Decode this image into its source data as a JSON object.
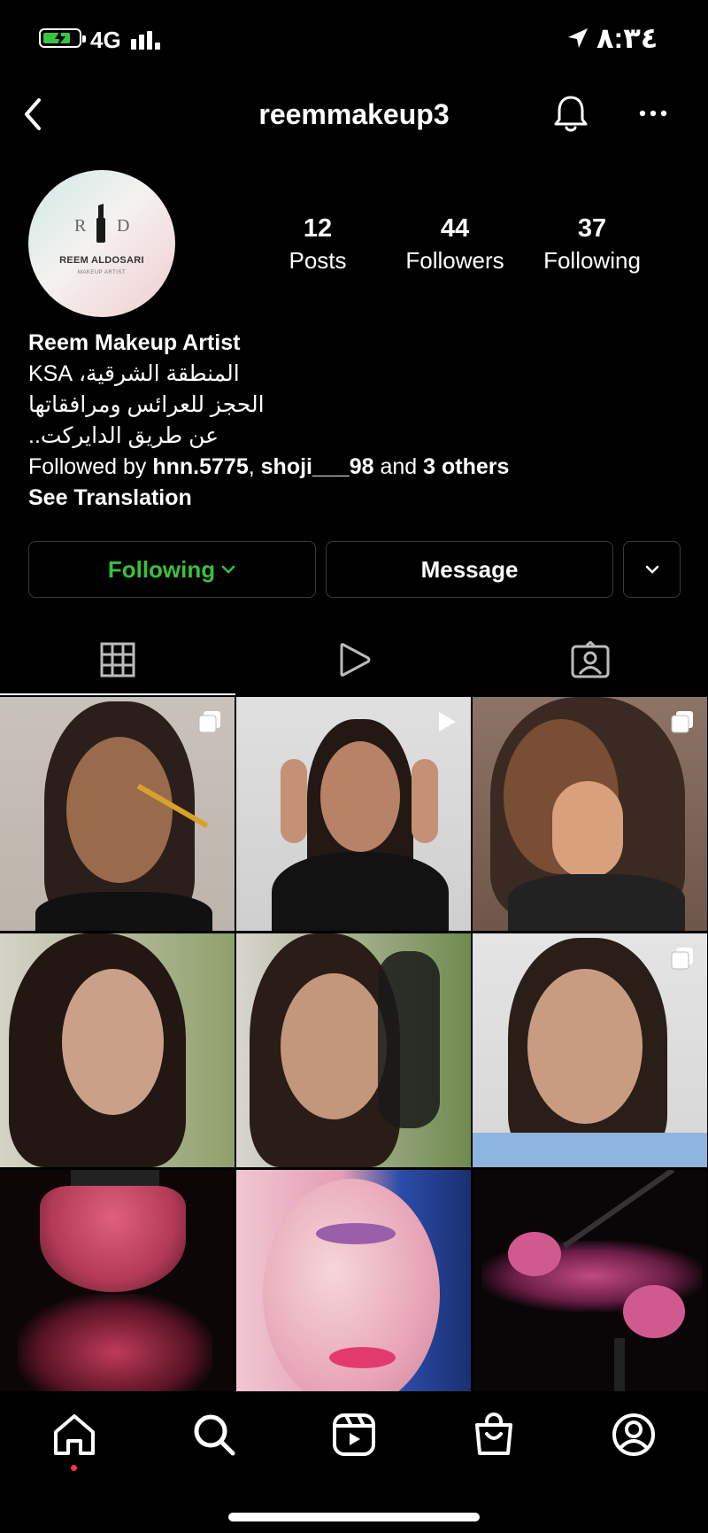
{
  "status_bar": {
    "network": "4G",
    "time": "٨:٣٤",
    "battery_charging": true
  },
  "header": {
    "username": "reemmakeup3"
  },
  "profile": {
    "avatar_text": {
      "left_letter": "R",
      "right_letter": "D",
      "brand": "REEM ALDOSARI",
      "sub": "MAKEUP ARTIST"
    },
    "stats": [
      {
        "value": "12",
        "label": "Posts"
      },
      {
        "value": "44",
        "label": "Followers"
      },
      {
        "value": "37",
        "label": "Following"
      }
    ],
    "name": "Reem Makeup Artist",
    "bio_lines": [
      "المنطقة الشرقية، KSA",
      "الحجز للعرائس ومرافقاتها",
      "عن طريق الدايركت.."
    ],
    "followed_by": {
      "prefix": "Followed by",
      "user1": "hnn.5775",
      "sep": ",",
      "user2": "shoji___98",
      "and": "and",
      "others": "3 others"
    },
    "see_translation": "See Translation"
  },
  "actions": {
    "following": "Following",
    "message": "Message"
  },
  "tabs": [
    {
      "icon": "grid-icon",
      "active": true
    },
    {
      "icon": "reels-icon",
      "active": false
    },
    {
      "icon": "tagged-icon",
      "active": false
    }
  ],
  "posts": [
    {
      "type": "carousel"
    },
    {
      "type": "reel"
    },
    {
      "type": "carousel"
    },
    {
      "type": "photo"
    },
    {
      "type": "photo"
    },
    {
      "type": "carousel"
    },
    {
      "type": "photo"
    },
    {
      "type": "photo"
    },
    {
      "type": "photo"
    }
  ],
  "bottom_nav": [
    "home-icon",
    "search-icon",
    "reels-icon",
    "shop-icon",
    "profile-icon"
  ],
  "colors": {
    "background": "#000000",
    "following_green": "#3cbf3c",
    "notification_dot": "#ff3040",
    "battery_green": "#39c542"
  }
}
